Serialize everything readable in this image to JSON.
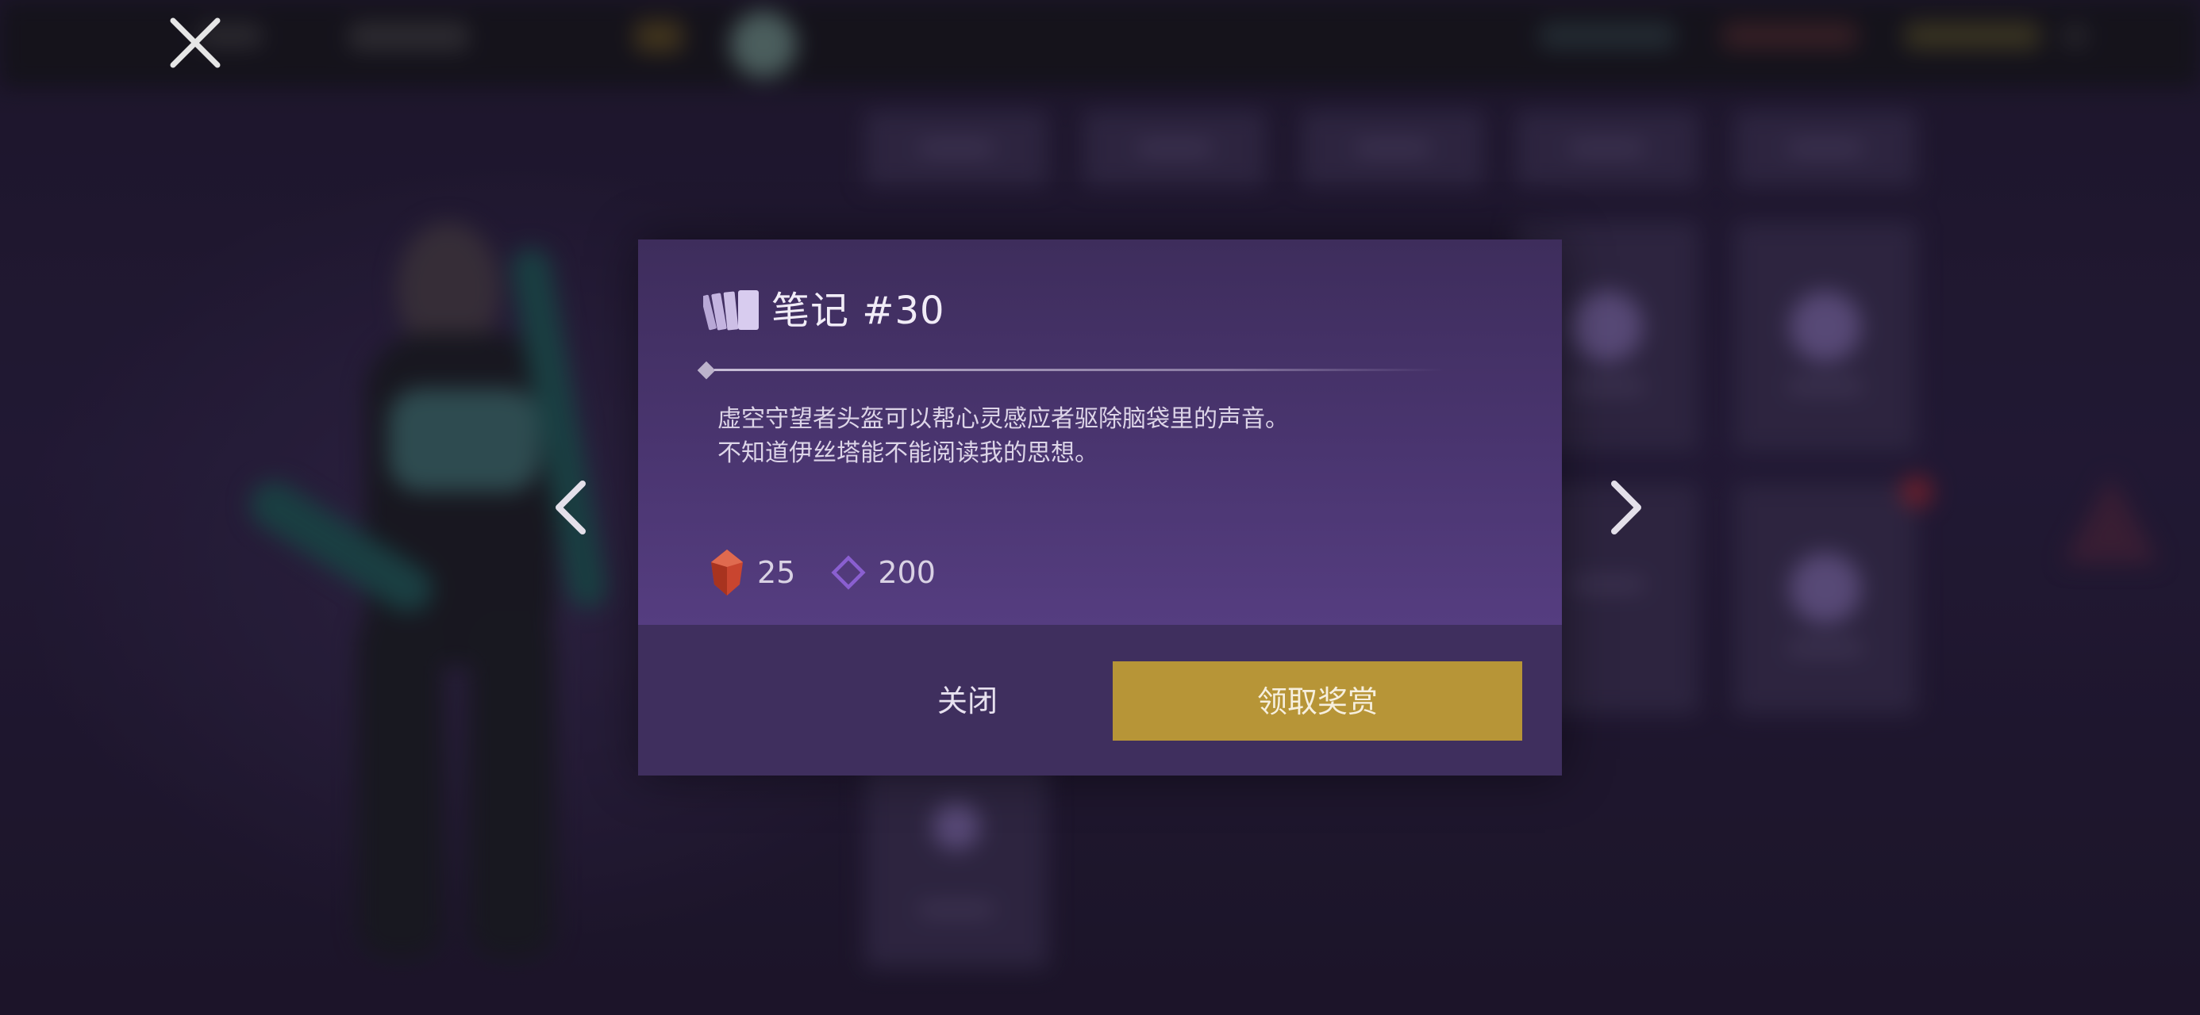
{
  "dialog": {
    "title": "笔记 #30",
    "title_icon": "cards-icon",
    "description_lines": [
      "虚空守望者头盔可以帮心灵感应者驱除脑袋里的声音。",
      "不知道伊丝塔能不能阅读我的思想。"
    ],
    "rewards": [
      {
        "icon": "red-crystal-icon",
        "value": "25",
        "color": "#c9452f"
      },
      {
        "icon": "purple-diamond-icon",
        "value": "200",
        "color": "#8a5fd0"
      }
    ],
    "close_label": "关闭",
    "claim_label": "领取奖赏"
  },
  "navigation": {
    "prev_icon": "chevron-left-icon",
    "next_icon": "chevron-right-icon",
    "exit_icon": "close-icon"
  },
  "colors": {
    "dialog_top": "#3e2d5c",
    "dialog_bottom": "#553d80",
    "footer": "#3f2f5e",
    "claim_button": "#b79537",
    "text_primary": "#f1ecf7"
  }
}
